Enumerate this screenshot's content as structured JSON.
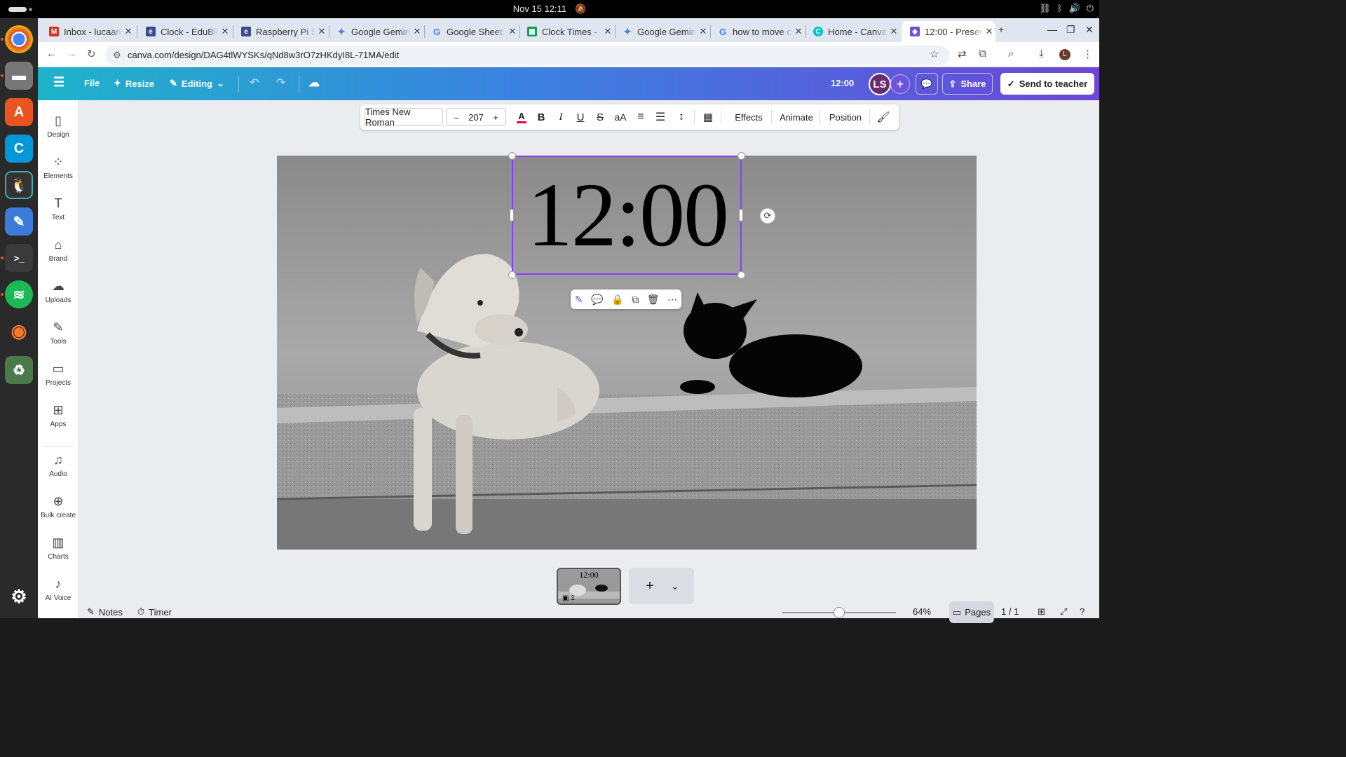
{
  "system": {
    "date": "Nov 15",
    "time": "12:11",
    "tray_icons": [
      "network-icon",
      "bluetooth-icon",
      "volume-icon",
      "power-icon"
    ]
  },
  "dock": {
    "apps": [
      "chrome",
      "files",
      "software",
      "codeblocks",
      "pinguy",
      "text-editor",
      "terminal",
      "spotify",
      "blender",
      "trash",
      "ubuntu"
    ]
  },
  "tabs": [
    {
      "title": "Inbox - lucaan",
      "icon": "gmail",
      "color": "#d93025"
    },
    {
      "title": "Clock - EduBlo",
      "icon": "edublocks",
      "color": "#3a4d8f"
    },
    {
      "title": "Raspberry Pi S",
      "icon": "edublocks",
      "color": "#3a4d8f"
    },
    {
      "title": "Google Gemin",
      "icon": "gemini",
      "color": "#4a7fe0"
    },
    {
      "title": "Google Sheet:",
      "icon": "google",
      "color": "#4285f4"
    },
    {
      "title": "Clock Times - ",
      "icon": "sheets",
      "color": "#0f9d58"
    },
    {
      "title": "Google Gemin",
      "icon": "gemini",
      "color": "#4a7fe0"
    },
    {
      "title": "how to move c",
      "icon": "google",
      "color": "#4285f4"
    },
    {
      "title": "Home - Canva",
      "icon": "canva",
      "color": "#00c4cc"
    },
    {
      "title": "12:00 - Presen",
      "icon": "canva",
      "color": "#6d52e0"
    }
  ],
  "address": {
    "url": "canva.com/design/DAG4tlWYSKs/qNd8w3rO7zHKdyI8L-71MA/edit"
  },
  "header": {
    "menu": "File",
    "resize": "Resize",
    "editing": "Editing",
    "title": "12:00",
    "avatar": "LS",
    "share": "Share",
    "send": "Send to teacher"
  },
  "sidebar": [
    {
      "label": "Design",
      "icon": "design-icon",
      "glyph": "▯"
    },
    {
      "label": "Elements",
      "icon": "elements-icon",
      "glyph": "⁘"
    },
    {
      "label": "Text",
      "icon": "text-icon",
      "glyph": "T"
    },
    {
      "label": "Brand",
      "icon": "brand-icon",
      "glyph": "⌂"
    },
    {
      "label": "Uploads",
      "icon": "uploads-icon",
      "glyph": "☁"
    },
    {
      "label": "Tools",
      "icon": "tools-icon",
      "glyph": "✎"
    },
    {
      "label": "Projects",
      "icon": "projects-icon",
      "glyph": "▭"
    },
    {
      "label": "Apps",
      "icon": "apps-icon",
      "glyph": "⊞"
    },
    {
      "label": "Audio",
      "icon": "audio-icon",
      "glyph": "♫"
    },
    {
      "label": "Bulk create",
      "icon": "bulk-create-icon",
      "glyph": "⊕"
    },
    {
      "label": "Charts",
      "icon": "charts-icon",
      "glyph": "▥"
    },
    {
      "label": "AI Voice",
      "icon": "ai-voice-icon",
      "glyph": "♪"
    }
  ],
  "toolbar": {
    "font": "Times New Roman",
    "size": "207",
    "effects": "Effects",
    "animate": "Animate",
    "position": "Position"
  },
  "canvas": {
    "text": "12:00"
  },
  "thumbnail": {
    "text": "12:00",
    "number": "1"
  },
  "footer": {
    "notes": "Notes",
    "timer": "Timer",
    "zoom": "64%",
    "zoom_level": 0.5,
    "pages": "Pages",
    "page_count": "1 / 1"
  }
}
